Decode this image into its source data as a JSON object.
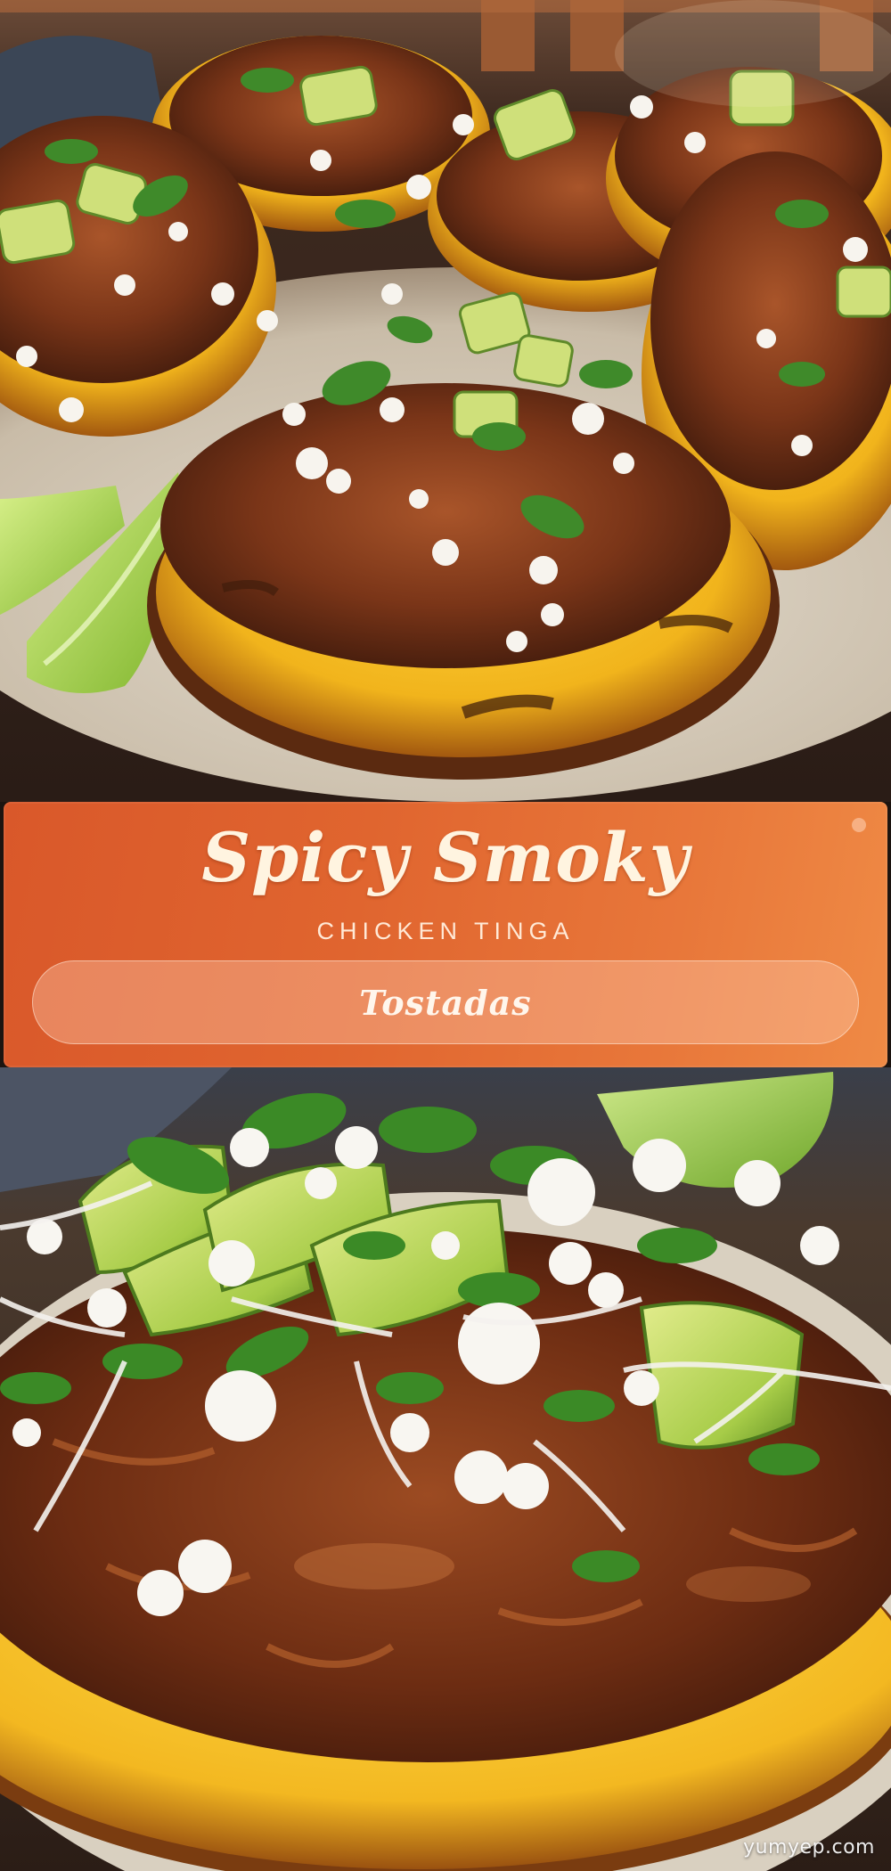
{
  "banner": {
    "title": "Spicy Smoky",
    "subtitle": "CHICKEN TINGA",
    "pill_label": "Tostadas"
  },
  "watermark": "yumyep.com",
  "images": {
    "top": "chicken-tinga-tostadas-platter-photo",
    "bottom": "chicken-tinga-tostada-closeup-photo"
  },
  "colors": {
    "banner_start": "#d9582a",
    "banner_end": "#ef8a45",
    "title_text": "#fff4e0"
  }
}
